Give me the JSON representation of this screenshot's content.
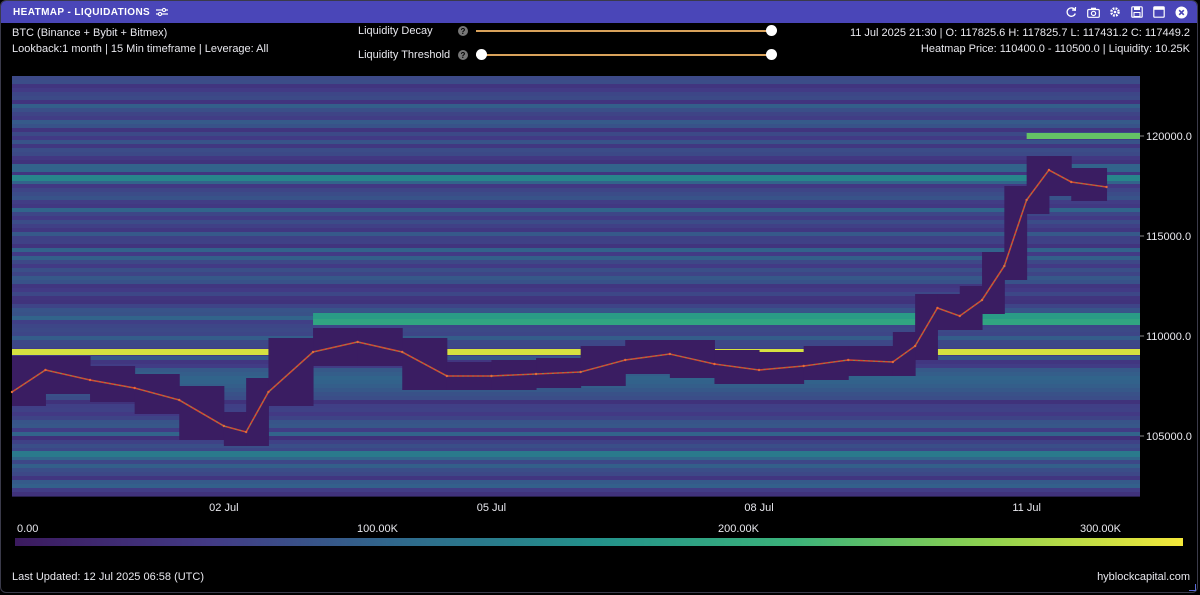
{
  "window": {
    "title": "HEATMAP - LIQUIDATIONS",
    "toolbar_icons": [
      "refresh-icon",
      "camera-icon",
      "gear-icon",
      "save-icon",
      "expand-icon",
      "close-icon"
    ]
  },
  "info": {
    "symbol": "BTC (Binance + Bybit + Bitmex)",
    "params": "Lookback:1 month | 15 Min timeframe | Leverage: All",
    "ohlc": "11 Jul 2025 21:30 | O: 117825.6 H: 117825.7 L: 117431.2 C: 117449.2",
    "heatmap_price": "Heatmap Price: 110400.0 - 110500.0 | Liquidity: 10.25K"
  },
  "controls": {
    "decay_label": "Liquidity Decay",
    "threshold_label": "Liquidity Threshold",
    "decay_value": 1.0,
    "threshold_range": [
      0.0,
      1.0
    ],
    "track_color": "#d9a25b"
  },
  "colorbar": {
    "labels": [
      "0.00",
      "100.00K",
      "200.00K",
      "300.00K"
    ],
    "stops": [
      "#3b1a5e",
      "#423a85",
      "#2f6a8c",
      "#23928b",
      "#3bb27a",
      "#8fd24f",
      "#f4e83a"
    ]
  },
  "footer": {
    "updated": "Last Updated: 12 Jul 2025 06:58 (UTC)",
    "brand": "hyblockcapital.com"
  },
  "chart_data": {
    "type": "heatmap",
    "xlabel": "",
    "ylabel": "",
    "x_ticks": [
      "02 Jul",
      "05 Jul",
      "08 Jul",
      "11 Jul"
    ],
    "y_ticks": [
      120000.0,
      115000.0,
      110000.0,
      105000.0
    ],
    "y_tick_labels": [
      "120000.0",
      "115000.0",
      "110000.0",
      "105000.0"
    ],
    "xlim": [
      "2025-06-29 15:00",
      "2025-07-12 06:30"
    ],
    "ylim": [
      102000,
      123000
    ],
    "zlim": [
      0,
      330000
    ],
    "price_series": {
      "name": "BTC",
      "x": [
        "2025-06-29 15:00",
        "2025-06-30 00:00",
        "2025-06-30 12:00",
        "2025-07-01 00:00",
        "2025-07-01 12:00",
        "2025-07-02 00:00",
        "2025-07-02 06:00",
        "2025-07-02 12:00",
        "2025-07-03 00:00",
        "2025-07-03 12:00",
        "2025-07-04 00:00",
        "2025-07-04 12:00",
        "2025-07-05 00:00",
        "2025-07-05 12:00",
        "2025-07-06 00:00",
        "2025-07-06 12:00",
        "2025-07-07 00:00",
        "2025-07-07 12:00",
        "2025-07-08 00:00",
        "2025-07-08 12:00",
        "2025-07-09 00:00",
        "2025-07-09 12:00",
        "2025-07-09 18:00",
        "2025-07-10 00:00",
        "2025-07-10 06:00",
        "2025-07-10 12:00",
        "2025-07-10 18:00",
        "2025-07-11 00:00",
        "2025-07-11 06:00",
        "2025-07-11 12:00",
        "2025-07-11 21:30"
      ],
      "y": [
        107200,
        108300,
        107800,
        107400,
        106800,
        105500,
        105200,
        107200,
        109200,
        109700,
        109200,
        108000,
        108000,
        108100,
        108200,
        108800,
        109100,
        108600,
        108300,
        108500,
        108800,
        108700,
        109500,
        111400,
        111000,
        111800,
        113500,
        116800,
        118300,
        117700,
        117450
      ]
    },
    "liquidity_bands": [
      {
        "price": 120000,
        "strength": 0.75,
        "from": "2025-07-11 00:00"
      },
      {
        "price": 117900,
        "strength": 0.45,
        "from": "2025-06-29 15:00"
      },
      {
        "price": 111000,
        "strength": 0.55,
        "from": "2025-07-03 00:00"
      },
      {
        "price": 110700,
        "strength": 0.6,
        "from": "2025-07-03 00:00"
      },
      {
        "price": 109200,
        "strength": 0.95,
        "from": "2025-06-29 15:00"
      },
      {
        "price": 104100,
        "strength": 0.4,
        "from": "2025-06-29 15:00"
      }
    ]
  }
}
